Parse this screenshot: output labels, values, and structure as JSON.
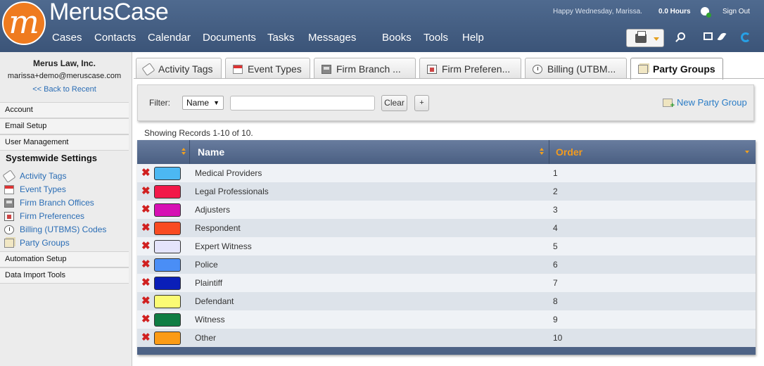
{
  "header": {
    "brand": "MerusCase",
    "greeting": "Happy Wednesday, Marissa.",
    "hours": "0.0 Hours",
    "sign_out": "Sign Out",
    "nav": [
      "Cases",
      "Contacts",
      "Calendar",
      "Documents",
      "Tasks",
      "Messages",
      "Books",
      "Tools",
      "Help"
    ],
    "icons": [
      "print-icon",
      "search-icon",
      "windows-icon",
      "feather-icon",
      "refresh-icon"
    ]
  },
  "sidebar": {
    "firm": "Merus Law, Inc.",
    "email": "marissa+demo@meruscase.com",
    "back": "<< Back to Recent",
    "sections": [
      "Account",
      "Email Setup",
      "User Management"
    ],
    "systemwide_title": "Systemwide Settings",
    "systemwide_items": [
      "Activity Tags",
      "Event Types",
      "Firm Branch Offices",
      "Firm Preferences",
      "Billing (UTBMS) Codes",
      "Party Groups"
    ],
    "bottom_sections": [
      "Automation Setup",
      "Data Import Tools"
    ]
  },
  "tabs": [
    "Activity Tags",
    "Event Types",
    "Firm Branch ...",
    "Firm Preferen...",
    "Billing (UTBM...",
    "Party Groups"
  ],
  "active_tab": 5,
  "filter": {
    "label": "Filter:",
    "field": "Name",
    "value": "",
    "clear": "Clear",
    "add": "+",
    "new_label": "New Party Group"
  },
  "records_text": "Showing Records 1-10 of 10.",
  "table": {
    "headers": {
      "name": "Name",
      "order": "Order"
    },
    "rows": [
      {
        "name": "Medical Providers",
        "order": "1",
        "color": "#4cb8f2"
      },
      {
        "name": "Legal Professionals",
        "order": "2",
        "color": "#f21849"
      },
      {
        "name": "Adjusters",
        "order": "3",
        "color": "#d610b4"
      },
      {
        "name": "Respondent",
        "order": "4",
        "color": "#f94b21"
      },
      {
        "name": "Expert Witness",
        "order": "5",
        "color": "#e4e4fb"
      },
      {
        "name": "Police",
        "order": "6",
        "color": "#4a8ef6"
      },
      {
        "name": "Plaintiff",
        "order": "7",
        "color": "#0a1fb8"
      },
      {
        "name": "Defendant",
        "order": "8",
        "color": "#fbfb74"
      },
      {
        "name": "Witness",
        "order": "9",
        "color": "#0f7d43"
      },
      {
        "name": "Other",
        "order": "10",
        "color": "#fb9b15"
      }
    ]
  }
}
